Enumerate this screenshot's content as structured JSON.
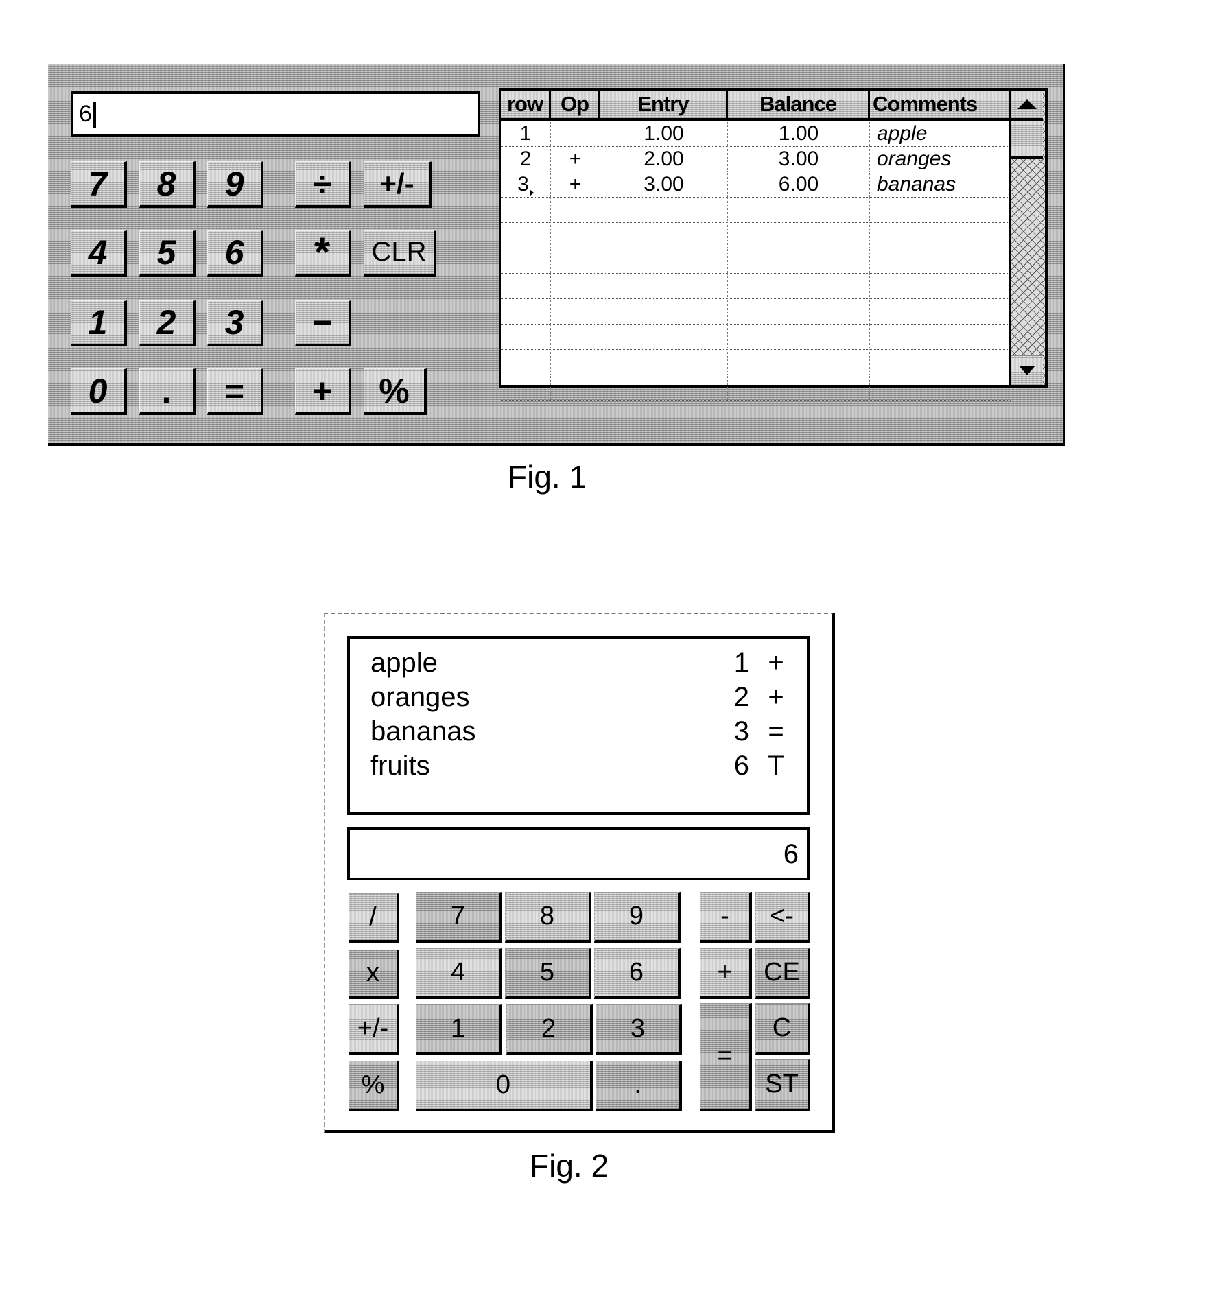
{
  "fig1": {
    "caption": "Fig. 1",
    "input": {
      "value": "6"
    },
    "keypad": [
      {
        "id": "7",
        "label": "7"
      },
      {
        "id": "8",
        "label": "8"
      },
      {
        "id": "9",
        "label": "9"
      },
      {
        "id": "divide",
        "label": "÷"
      },
      {
        "id": "plus-minus",
        "label": "+/-"
      },
      {
        "id": "4",
        "label": "4"
      },
      {
        "id": "5",
        "label": "5"
      },
      {
        "id": "6",
        "label": "6"
      },
      {
        "id": "multiply",
        "label": "*"
      },
      {
        "id": "clear",
        "label": "CLR"
      },
      {
        "id": "1",
        "label": "1"
      },
      {
        "id": "2",
        "label": "2"
      },
      {
        "id": "3",
        "label": "3"
      },
      {
        "id": "minus",
        "label": "−"
      },
      {
        "id": "0",
        "label": "0"
      },
      {
        "id": "decimal",
        "label": "."
      },
      {
        "id": "equals",
        "label": "="
      },
      {
        "id": "plus",
        "label": "+"
      },
      {
        "id": "percent",
        "label": "%"
      }
    ],
    "table": {
      "columns": [
        "row",
        "Op",
        "Entry",
        "Balance",
        "Comments"
      ],
      "rows": [
        {
          "row": "1",
          "op": "",
          "entry": "1.00",
          "balance": "1.00",
          "comment": "apple"
        },
        {
          "row": "2",
          "op": "+",
          "entry": "2.00",
          "balance": "3.00",
          "comment": "oranges"
        },
        {
          "row": "3",
          "op": "+",
          "entry": "3.00",
          "balance": "6.00",
          "comment": "bananas"
        }
      ],
      "empty_rows": 8
    }
  },
  "fig2": {
    "caption": "Fig. 2",
    "tape": [
      {
        "name": "apple",
        "value": "1",
        "op": "+"
      },
      {
        "name": "oranges",
        "value": "2",
        "op": "+"
      },
      {
        "name": "bananas",
        "value": "3",
        "op": "="
      },
      {
        "name": "fruits",
        "value": "6",
        "op": "T"
      }
    ],
    "display": "6",
    "keypad": {
      "divide": "/",
      "multiply": "x",
      "plus_minus": "+/-",
      "percent": "%",
      "seven": "7",
      "eight": "8",
      "nine": "9",
      "four": "4",
      "five": "5",
      "six": "6",
      "one": "1",
      "two": "2",
      "three": "3",
      "zero": "0",
      "decimal": ".",
      "minus": "-",
      "backspace": "<-",
      "plus": "+",
      "clear_entry": "CE",
      "equals": "=",
      "clear": "C",
      "store": "ST"
    }
  }
}
